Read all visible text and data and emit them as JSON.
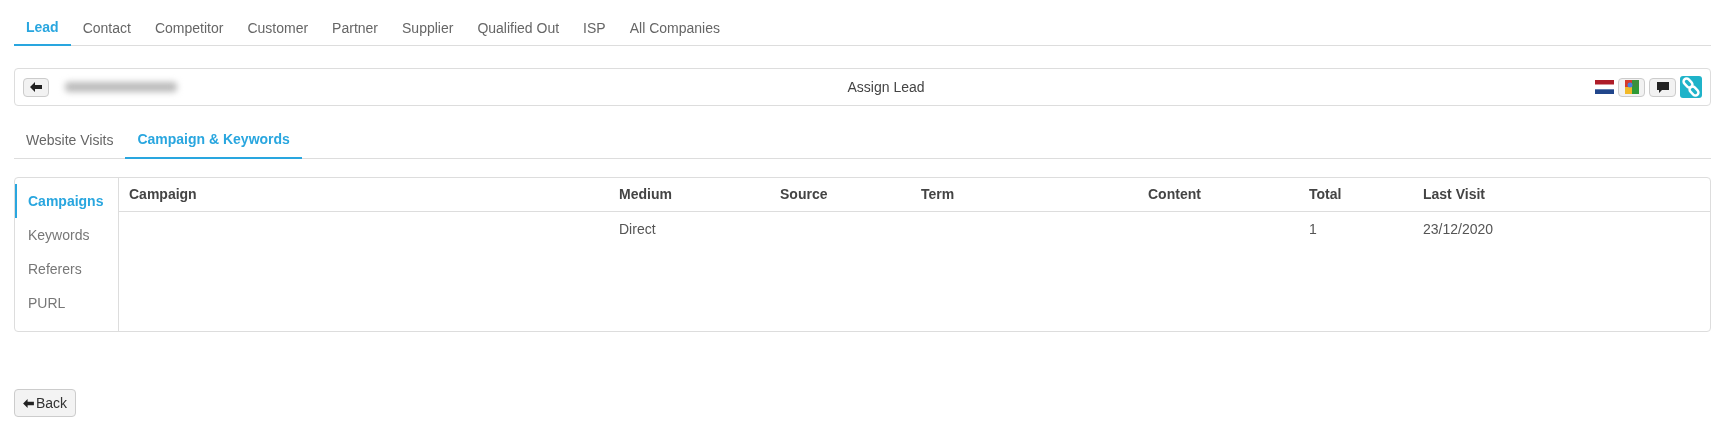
{
  "top_tabs": [
    {
      "label": "Lead",
      "selected": true
    },
    {
      "label": "Contact",
      "selected": false
    },
    {
      "label": "Competitor",
      "selected": false
    },
    {
      "label": "Customer",
      "selected": false
    },
    {
      "label": "Partner",
      "selected": false
    },
    {
      "label": "Supplier",
      "selected": false
    },
    {
      "label": "Qualified Out",
      "selected": false
    },
    {
      "label": "ISP",
      "selected": false
    },
    {
      "label": "All Companies",
      "selected": false
    }
  ],
  "header": {
    "title": "Assign Lead"
  },
  "sub_tabs": [
    {
      "label": "Website Visits",
      "selected": false
    },
    {
      "label": "Campaign & Keywords",
      "selected": true
    }
  ],
  "side_nav": [
    {
      "label": "Campaigns",
      "selected": true
    },
    {
      "label": "Keywords",
      "selected": false
    },
    {
      "label": "Referers",
      "selected": false
    },
    {
      "label": "PURL",
      "selected": false
    }
  ],
  "table": {
    "columns": [
      "Campaign",
      "Medium",
      "Source",
      "Term",
      "Content",
      "Total",
      "Last Visit"
    ],
    "rows": [
      [
        null,
        "Direct",
        null,
        null,
        null,
        "1",
        "23/12/2020"
      ]
    ]
  },
  "back_button": {
    "label": "Back"
  }
}
